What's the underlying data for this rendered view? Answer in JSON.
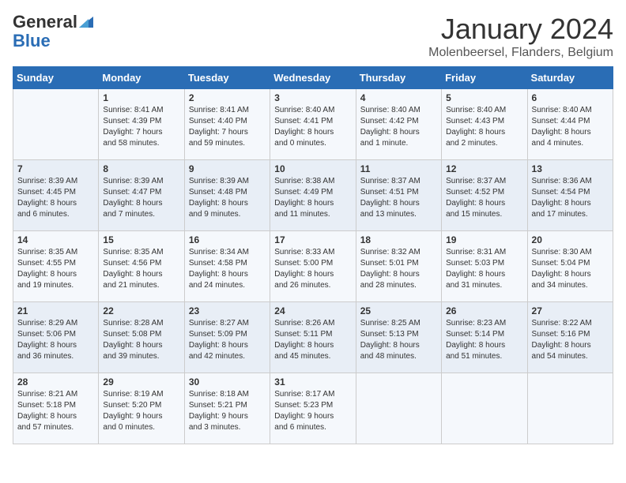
{
  "header": {
    "logo_general": "General",
    "logo_blue": "Blue",
    "month": "January 2024",
    "location": "Molenbeersel, Flanders, Belgium"
  },
  "days_of_week": [
    "Sunday",
    "Monday",
    "Tuesday",
    "Wednesday",
    "Thursday",
    "Friday",
    "Saturday"
  ],
  "weeks": [
    [
      {
        "day": "",
        "info": ""
      },
      {
        "day": "1",
        "info": "Sunrise: 8:41 AM\nSunset: 4:39 PM\nDaylight: 7 hours\nand 58 minutes."
      },
      {
        "day": "2",
        "info": "Sunrise: 8:41 AM\nSunset: 4:40 PM\nDaylight: 7 hours\nand 59 minutes."
      },
      {
        "day": "3",
        "info": "Sunrise: 8:40 AM\nSunset: 4:41 PM\nDaylight: 8 hours\nand 0 minutes."
      },
      {
        "day": "4",
        "info": "Sunrise: 8:40 AM\nSunset: 4:42 PM\nDaylight: 8 hours\nand 1 minute."
      },
      {
        "day": "5",
        "info": "Sunrise: 8:40 AM\nSunset: 4:43 PM\nDaylight: 8 hours\nand 2 minutes."
      },
      {
        "day": "6",
        "info": "Sunrise: 8:40 AM\nSunset: 4:44 PM\nDaylight: 8 hours\nand 4 minutes."
      }
    ],
    [
      {
        "day": "7",
        "info": "Sunrise: 8:39 AM\nSunset: 4:45 PM\nDaylight: 8 hours\nand 6 minutes."
      },
      {
        "day": "8",
        "info": "Sunrise: 8:39 AM\nSunset: 4:47 PM\nDaylight: 8 hours\nand 7 minutes."
      },
      {
        "day": "9",
        "info": "Sunrise: 8:39 AM\nSunset: 4:48 PM\nDaylight: 8 hours\nand 9 minutes."
      },
      {
        "day": "10",
        "info": "Sunrise: 8:38 AM\nSunset: 4:49 PM\nDaylight: 8 hours\nand 11 minutes."
      },
      {
        "day": "11",
        "info": "Sunrise: 8:37 AM\nSunset: 4:51 PM\nDaylight: 8 hours\nand 13 minutes."
      },
      {
        "day": "12",
        "info": "Sunrise: 8:37 AM\nSunset: 4:52 PM\nDaylight: 8 hours\nand 15 minutes."
      },
      {
        "day": "13",
        "info": "Sunrise: 8:36 AM\nSunset: 4:54 PM\nDaylight: 8 hours\nand 17 minutes."
      }
    ],
    [
      {
        "day": "14",
        "info": "Sunrise: 8:35 AM\nSunset: 4:55 PM\nDaylight: 8 hours\nand 19 minutes."
      },
      {
        "day": "15",
        "info": "Sunrise: 8:35 AM\nSunset: 4:56 PM\nDaylight: 8 hours\nand 21 minutes."
      },
      {
        "day": "16",
        "info": "Sunrise: 8:34 AM\nSunset: 4:58 PM\nDaylight: 8 hours\nand 24 minutes."
      },
      {
        "day": "17",
        "info": "Sunrise: 8:33 AM\nSunset: 5:00 PM\nDaylight: 8 hours\nand 26 minutes."
      },
      {
        "day": "18",
        "info": "Sunrise: 8:32 AM\nSunset: 5:01 PM\nDaylight: 8 hours\nand 28 minutes."
      },
      {
        "day": "19",
        "info": "Sunrise: 8:31 AM\nSunset: 5:03 PM\nDaylight: 8 hours\nand 31 minutes."
      },
      {
        "day": "20",
        "info": "Sunrise: 8:30 AM\nSunset: 5:04 PM\nDaylight: 8 hours\nand 34 minutes."
      }
    ],
    [
      {
        "day": "21",
        "info": "Sunrise: 8:29 AM\nSunset: 5:06 PM\nDaylight: 8 hours\nand 36 minutes."
      },
      {
        "day": "22",
        "info": "Sunrise: 8:28 AM\nSunset: 5:08 PM\nDaylight: 8 hours\nand 39 minutes."
      },
      {
        "day": "23",
        "info": "Sunrise: 8:27 AM\nSunset: 5:09 PM\nDaylight: 8 hours\nand 42 minutes."
      },
      {
        "day": "24",
        "info": "Sunrise: 8:26 AM\nSunset: 5:11 PM\nDaylight: 8 hours\nand 45 minutes."
      },
      {
        "day": "25",
        "info": "Sunrise: 8:25 AM\nSunset: 5:13 PM\nDaylight: 8 hours\nand 48 minutes."
      },
      {
        "day": "26",
        "info": "Sunrise: 8:23 AM\nSunset: 5:14 PM\nDaylight: 8 hours\nand 51 minutes."
      },
      {
        "day": "27",
        "info": "Sunrise: 8:22 AM\nSunset: 5:16 PM\nDaylight: 8 hours\nand 54 minutes."
      }
    ],
    [
      {
        "day": "28",
        "info": "Sunrise: 8:21 AM\nSunset: 5:18 PM\nDaylight: 8 hours\nand 57 minutes."
      },
      {
        "day": "29",
        "info": "Sunrise: 8:19 AM\nSunset: 5:20 PM\nDaylight: 9 hours\nand 0 minutes."
      },
      {
        "day": "30",
        "info": "Sunrise: 8:18 AM\nSunset: 5:21 PM\nDaylight: 9 hours\nand 3 minutes."
      },
      {
        "day": "31",
        "info": "Sunrise: 8:17 AM\nSunset: 5:23 PM\nDaylight: 9 hours\nand 6 minutes."
      },
      {
        "day": "",
        "info": ""
      },
      {
        "day": "",
        "info": ""
      },
      {
        "day": "",
        "info": ""
      }
    ]
  ]
}
